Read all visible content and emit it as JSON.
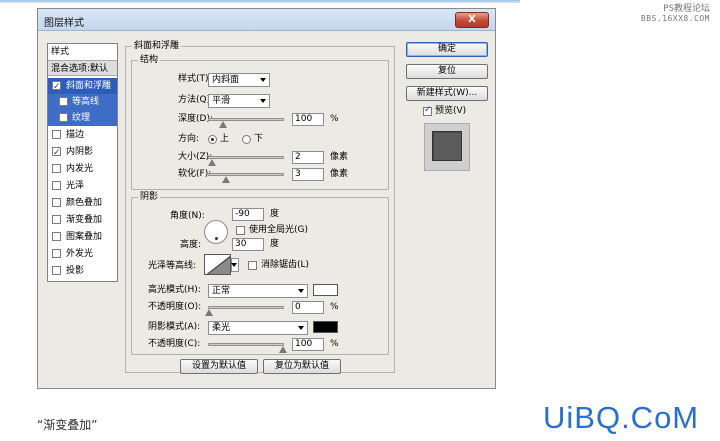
{
  "watermark_top": {
    "line1": "PS教程论坛",
    "line2": "BBS.16XX8.COM"
  },
  "dialog": {
    "title": "图层样式",
    "close": "X"
  },
  "styles_panel": {
    "header": "样式",
    "blend_options": "混合选项:默认",
    "items": [
      {
        "label": "斜面和浮雕",
        "checked": true,
        "selected": true
      },
      {
        "label": "等高线",
        "checked": false,
        "sub": true
      },
      {
        "label": "纹理",
        "checked": false,
        "sub": true
      },
      {
        "label": "描边",
        "checked": false
      },
      {
        "label": "内阴影",
        "checked": true
      },
      {
        "label": "内发光",
        "checked": false
      },
      {
        "label": "光泽",
        "checked": false
      },
      {
        "label": "颜色叠加",
        "checked": false
      },
      {
        "label": "渐变叠加",
        "checked": false
      },
      {
        "label": "图案叠加",
        "checked": false
      },
      {
        "label": "外发光",
        "checked": false
      },
      {
        "label": "投影",
        "checked": false
      }
    ]
  },
  "bevel": {
    "title": "斜面和浮雕",
    "structure": {
      "title": "结构",
      "style_label": "样式(T):",
      "style_value": "内斜面",
      "technique_label": "方法(Q):",
      "technique_value": "平滑",
      "depth_label": "深度(D):",
      "depth_value": "100",
      "depth_unit": "%",
      "direction_label": "方向:",
      "up": "上",
      "down": "下",
      "size_label": "大小(Z):",
      "size_value": "2",
      "size_unit": "像素",
      "soften_label": "软化(F):",
      "soften_value": "3",
      "soften_unit": "像素"
    },
    "shading": {
      "title": "阴影",
      "angle_label": "角度(N):",
      "angle_value": "-90",
      "angle_unit": "度",
      "global_light": "使用全局光(G)",
      "altitude_label": "高度:",
      "altitude_value": "30",
      "altitude_unit": "度",
      "gloss_label": "光泽等高线:",
      "antialias": "消除锯齿(L)",
      "highlight_mode_label": "高光模式(H):",
      "highlight_mode_value": "正常",
      "highlight_opacity_label": "不透明度(O):",
      "highlight_opacity_value": "0",
      "highlight_opacity_unit": "%",
      "shadow_mode_label": "阴影模式(A):",
      "shadow_mode_value": "柔光",
      "shadow_opacity_label": "不透明度(C):",
      "shadow_opacity_value": "100",
      "shadow_opacity_unit": "%"
    },
    "make_default": "设置为默认值",
    "reset_default": "复位为默认值"
  },
  "buttons": {
    "ok": "确定",
    "reset": "复位",
    "new_style": "新建样式(W)..."
  },
  "preview": {
    "label": "预览(V)",
    "checked": true
  },
  "colors": {
    "highlight": "#ffffff",
    "shadow": "#000000"
  },
  "caption": "“渐变叠加”",
  "brand": "UiBQ.CoM"
}
